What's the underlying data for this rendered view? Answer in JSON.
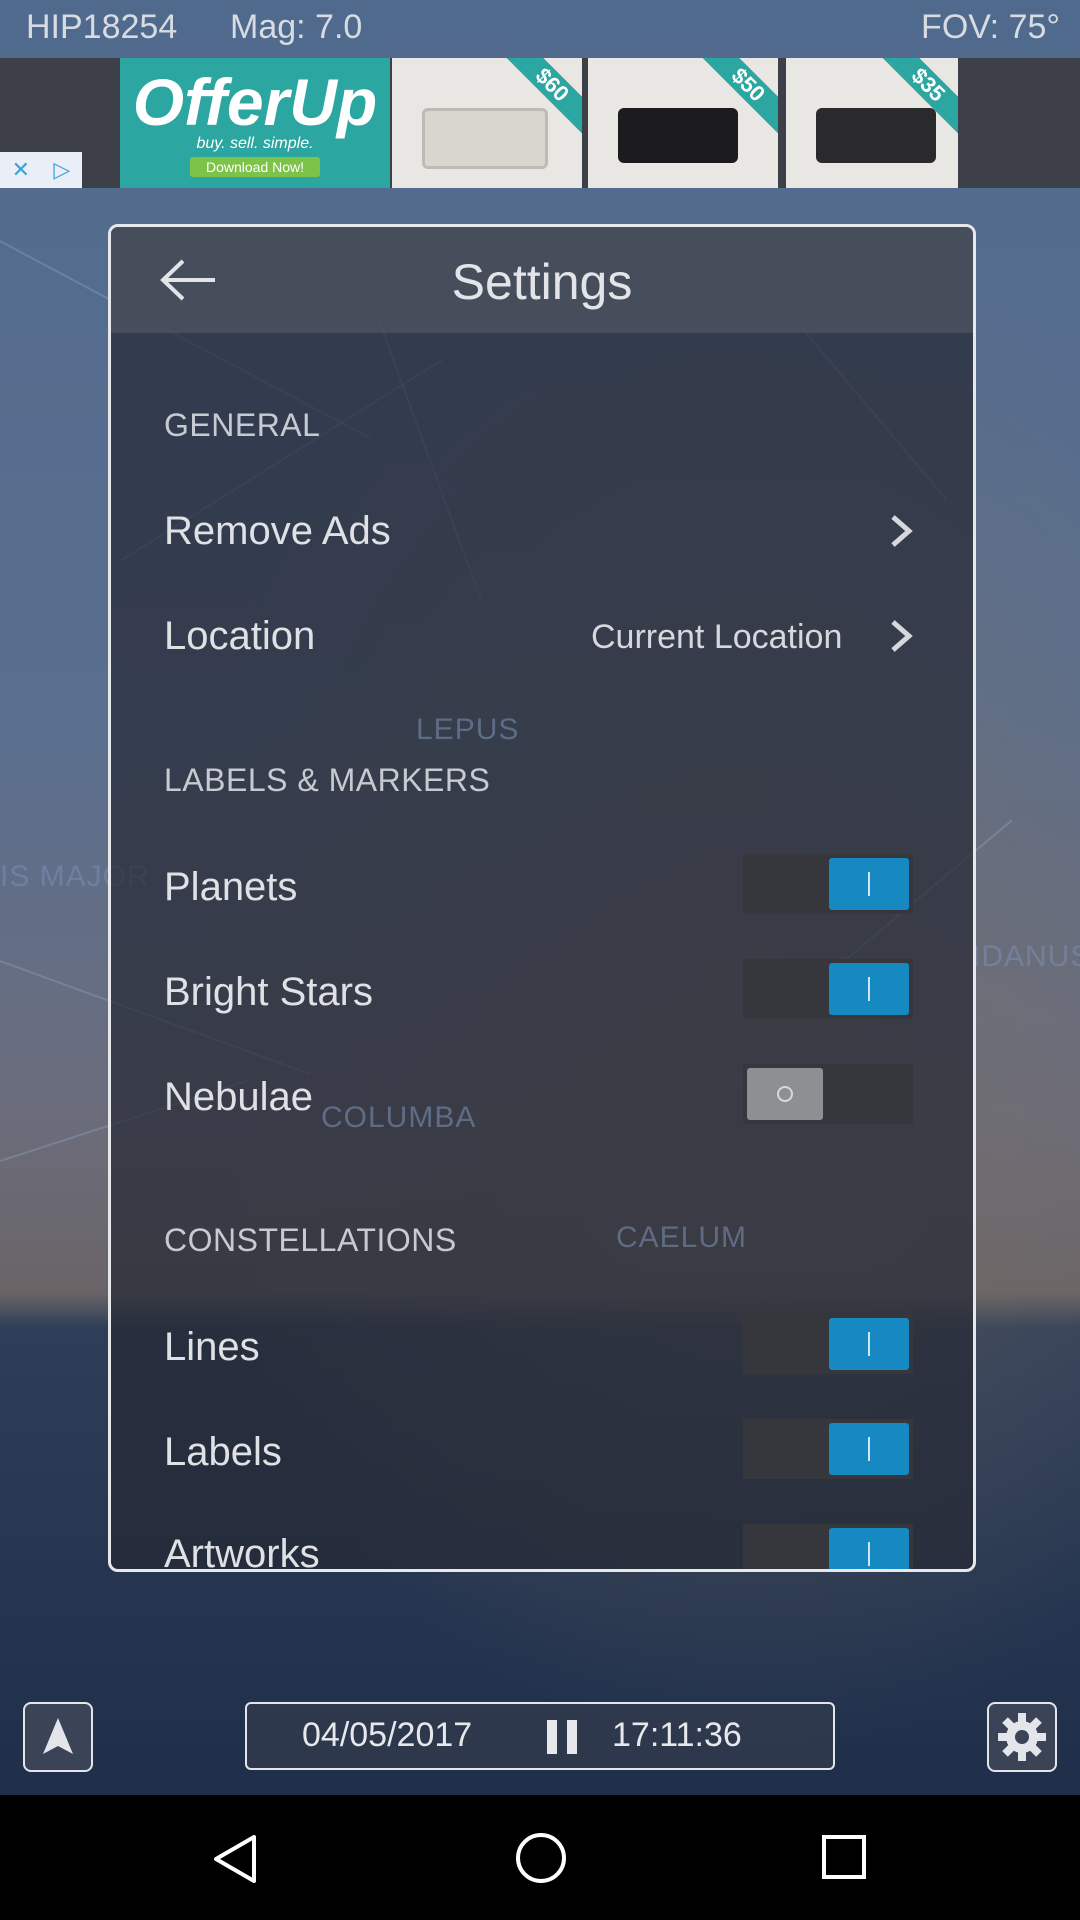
{
  "status": {
    "star_id": "HIP18254",
    "magnitude": "Mag: 7.0",
    "fov": "FOV: 75°"
  },
  "ad": {
    "brand": "OfferUp",
    "tagline": "buy. sell. simple.",
    "cta": "Download Now!",
    "prices": [
      "$60",
      "$50",
      "$35"
    ]
  },
  "sky_labels": {
    "lepus": "LEPUS",
    "columba": "COLUMBA",
    "caelum": "CAELUM",
    "eridanus": "IDANUS",
    "canis": "IS MAJOR"
  },
  "settings": {
    "title": "Settings",
    "general": {
      "header": "GENERAL",
      "remove_ads": "Remove Ads",
      "location_label": "Location",
      "location_value": "Current Location"
    },
    "labels_markers": {
      "header": "LABELS & MARKERS",
      "planets": {
        "label": "Planets",
        "on": true
      },
      "bright_stars": {
        "label": "Bright Stars",
        "on": true
      },
      "nebulae": {
        "label": "Nebulae",
        "on": false
      }
    },
    "constellations": {
      "header": "CONSTELLATIONS",
      "lines": {
        "label": "Lines",
        "on": true
      },
      "labels": {
        "label": "Labels",
        "on": true
      },
      "artworks": {
        "label": "Artworks",
        "on": true
      }
    }
  },
  "bottom": {
    "date": "04/05/2017",
    "time": "17:11:36"
  },
  "colors": {
    "toggle_on": "#1688c2",
    "toggle_off": "#8e8f93"
  }
}
